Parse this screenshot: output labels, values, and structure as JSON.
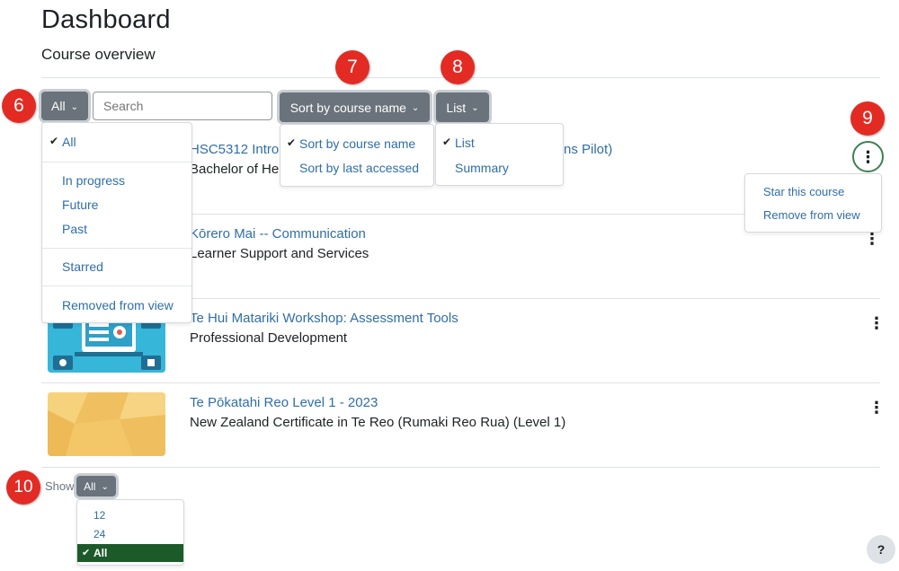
{
  "page": {
    "title": "Dashboard",
    "subtitle": "Course overview"
  },
  "filter": {
    "button_label": "All",
    "options": [
      "All",
      "In progress",
      "Future",
      "Past",
      "Starred",
      "Removed from view"
    ],
    "selected": "All"
  },
  "search": {
    "placeholder": "Search"
  },
  "sort": {
    "button_label": "Sort by course name",
    "options": [
      "Sort by course name",
      "Sort by last accessed"
    ],
    "selected": "Sort by course name"
  },
  "view": {
    "button_label": "List",
    "options": [
      "List",
      "Summary"
    ],
    "selected": "List"
  },
  "course_actions_menu": {
    "items": [
      "Star this course",
      "Remove from view"
    ]
  },
  "courses": [
    {
      "name_visible_start": "HSC5312 Intro",
      "name_visible_end": "ns Pilot)",
      "category": "Bachelor of He"
    },
    {
      "name": "Kōrero Mai -- Communication",
      "category": "Learner Support and Services"
    },
    {
      "name": "Te Hui Matariki Workshop: Assessment Tools",
      "category": "Professional Development"
    },
    {
      "name": "Te Pōkatahi Reo Level 1 - 2023",
      "category": "New Zealand Certificate in Te Reo (Rumaki Reo Rua) (Level 1)"
    }
  ],
  "paging": {
    "show_label": "Show",
    "button_label": "All",
    "options": [
      "12",
      "24",
      "All"
    ],
    "selected": "All"
  },
  "annotations": [
    "6",
    "7",
    "8",
    "9",
    "10"
  ],
  "help": {
    "label": "?"
  },
  "icons": {
    "check": "check-icon",
    "chevron": "chevron-down-icon",
    "kebab": "kebab-menu-icon"
  },
  "colors": {
    "link": "#2f6ea7",
    "button": "#6a737b",
    "badge": "#e32b24",
    "selected_row": "#1d5a2a",
    "kebab_ring": "#3f7f52"
  }
}
